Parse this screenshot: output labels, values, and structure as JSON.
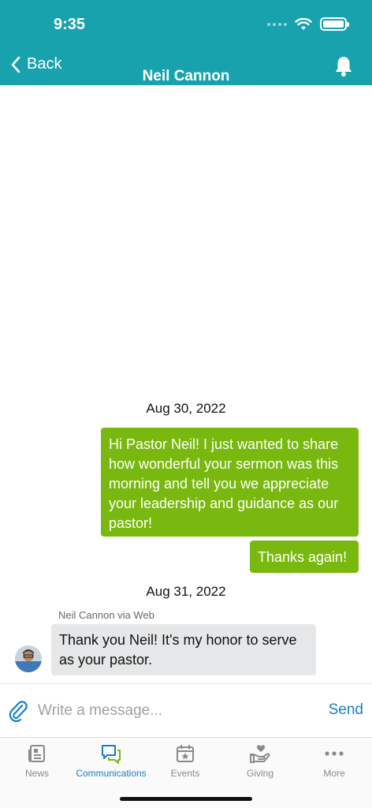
{
  "status_bar": {
    "time": "9:35"
  },
  "nav": {
    "back_label": "Back",
    "title": "Neil Cannon"
  },
  "conversation": {
    "date_1": "Aug 30, 2022",
    "outgoing_1": "Hi Pastor Neil! I just wanted to share how wonderful your sermon was this morning and tell you we appreciate your leadership and guidance as our pastor!",
    "outgoing_2": "Thanks again!",
    "date_2": "Aug 31, 2022",
    "incoming_sender": "Neil Cannon via Web",
    "incoming_1": "Thank you Neil! It's my honor to serve as your pastor."
  },
  "composer": {
    "placeholder": "Write a message...",
    "send_label": "Send"
  },
  "tabs": [
    {
      "label": "News",
      "icon": "news-icon"
    },
    {
      "label": "Communications",
      "icon": "communications-icon"
    },
    {
      "label": "Events",
      "icon": "events-icon"
    },
    {
      "label": "Giving",
      "icon": "giving-icon"
    },
    {
      "label": "More",
      "icon": "more-icon"
    }
  ],
  "active_tab": "Communications",
  "colors": {
    "header": "#17a2ad",
    "outgoing_bubble": "#79b80f",
    "incoming_bubble": "#e6e7e8",
    "accent": "#1a7fc0"
  }
}
